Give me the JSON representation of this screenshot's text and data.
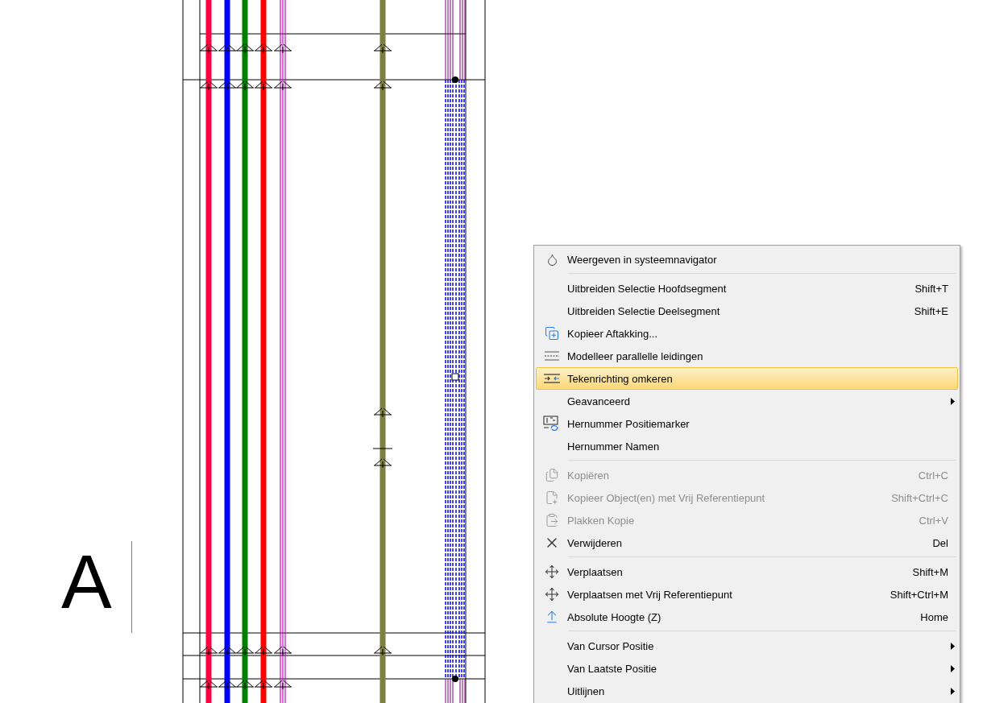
{
  "section_label": "A",
  "context_menu": {
    "items": [
      {
        "kind": "item",
        "label": "Weergeven in systeemnavigator",
        "disabled": false,
        "selected": false,
        "submenu": false
      },
      {
        "kind": "separator"
      },
      {
        "kind": "item",
        "label": "Uitbreiden Selectie Hoofdsegment",
        "shortcut": "Shift+T",
        "disabled": false,
        "selected": false,
        "submenu": false
      },
      {
        "kind": "item",
        "label": "Uitbreiden Selectie Deelsegment",
        "shortcut": "Shift+E",
        "disabled": false,
        "selected": false,
        "submenu": false
      },
      {
        "kind": "item",
        "label": "Kopieer Aftakking...",
        "disabled": false,
        "selected": false,
        "submenu": false
      },
      {
        "kind": "item",
        "label": "Modelleer parallelle leidingen",
        "disabled": false,
        "selected": false,
        "submenu": false
      },
      {
        "kind": "item",
        "label": "Tekenrichting omkeren",
        "disabled": false,
        "selected": true,
        "submenu": false
      },
      {
        "kind": "item",
        "label": "Geavanceerd",
        "disabled": false,
        "selected": false,
        "submenu": true
      },
      {
        "kind": "item",
        "label": "Hernummer Positiemarker",
        "disabled": false,
        "selected": false,
        "submenu": false
      },
      {
        "kind": "item",
        "label": "Hernummer Namen",
        "disabled": false,
        "selected": false,
        "submenu": false
      },
      {
        "kind": "separator"
      },
      {
        "kind": "item",
        "label": "Kopiëren",
        "shortcut": "Ctrl+C",
        "disabled": true,
        "selected": false,
        "submenu": false
      },
      {
        "kind": "item",
        "label": "Kopieer Object(en) met Vrij Referentiepunt",
        "shortcut": "Shift+Ctrl+C",
        "disabled": true,
        "selected": false,
        "submenu": false
      },
      {
        "kind": "item",
        "label": "Plakken Kopie",
        "shortcut": "Ctrl+V",
        "disabled": true,
        "selected": false,
        "submenu": false
      },
      {
        "kind": "item",
        "label": "Verwijderen",
        "shortcut": "Del",
        "disabled": false,
        "selected": false,
        "submenu": false
      },
      {
        "kind": "separator"
      },
      {
        "kind": "item",
        "label": "Verplaatsen",
        "shortcut": "Shift+M",
        "disabled": false,
        "selected": false,
        "submenu": false
      },
      {
        "kind": "item",
        "label": "Verplaatsen met Vrij Referentiepunt",
        "shortcut": "Shift+Ctrl+M",
        "disabled": false,
        "selected": false,
        "submenu": false
      },
      {
        "kind": "item",
        "label": "Absolute Hoogte (Z)",
        "shortcut": "Home",
        "disabled": false,
        "selected": false,
        "submenu": false
      },
      {
        "kind": "separator"
      },
      {
        "kind": "item",
        "label": "Van Cursor Positie",
        "disabled": false,
        "selected": false,
        "submenu": true
      },
      {
        "kind": "item",
        "label": "Van Laatste Positie",
        "disabled": false,
        "selected": false,
        "submenu": true
      },
      {
        "kind": "item",
        "label": "Uitlijnen",
        "disabled": false,
        "selected": false,
        "submenu": true
      }
    ]
  }
}
